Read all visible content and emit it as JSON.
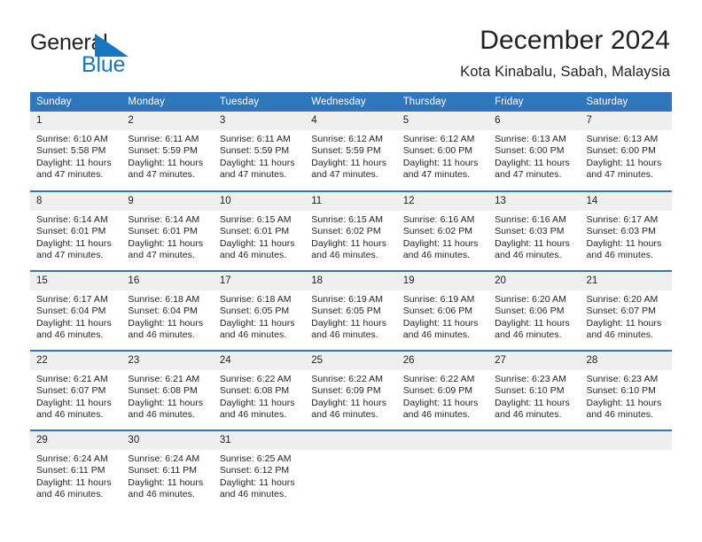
{
  "brand": {
    "name_part1": "General",
    "name_part2": "Blue",
    "triangle_icon": "triangle-icon",
    "accent_color": "#1676c0"
  },
  "header": {
    "title": "December 2024",
    "subtitle": "Kota Kinabalu, Sabah, Malaysia"
  },
  "theme": {
    "header_blue": "#2f76bc",
    "daynum_gray": "#efefef",
    "text": "#231f20"
  },
  "calendar": {
    "weekday_headers": [
      "Sunday",
      "Monday",
      "Tuesday",
      "Wednesday",
      "Thursday",
      "Friday",
      "Saturday"
    ],
    "weeks": [
      [
        {
          "day": "1",
          "sunrise": "Sunrise: 6:10 AM",
          "sunset": "Sunset: 5:58 PM",
          "daylight": "Daylight: 11 hours and 47 minutes."
        },
        {
          "day": "2",
          "sunrise": "Sunrise: 6:11 AM",
          "sunset": "Sunset: 5:59 PM",
          "daylight": "Daylight: 11 hours and 47 minutes."
        },
        {
          "day": "3",
          "sunrise": "Sunrise: 6:11 AM",
          "sunset": "Sunset: 5:59 PM",
          "daylight": "Daylight: 11 hours and 47 minutes."
        },
        {
          "day": "4",
          "sunrise": "Sunrise: 6:12 AM",
          "sunset": "Sunset: 5:59 PM",
          "daylight": "Daylight: 11 hours and 47 minutes."
        },
        {
          "day": "5",
          "sunrise": "Sunrise: 6:12 AM",
          "sunset": "Sunset: 6:00 PM",
          "daylight": "Daylight: 11 hours and 47 minutes."
        },
        {
          "day": "6",
          "sunrise": "Sunrise: 6:13 AM",
          "sunset": "Sunset: 6:00 PM",
          "daylight": "Daylight: 11 hours and 47 minutes."
        },
        {
          "day": "7",
          "sunrise": "Sunrise: 6:13 AM",
          "sunset": "Sunset: 6:00 PM",
          "daylight": "Daylight: 11 hours and 47 minutes."
        }
      ],
      [
        {
          "day": "8",
          "sunrise": "Sunrise: 6:14 AM",
          "sunset": "Sunset: 6:01 PM",
          "daylight": "Daylight: 11 hours and 47 minutes."
        },
        {
          "day": "9",
          "sunrise": "Sunrise: 6:14 AM",
          "sunset": "Sunset: 6:01 PM",
          "daylight": "Daylight: 11 hours and 47 minutes."
        },
        {
          "day": "10",
          "sunrise": "Sunrise: 6:15 AM",
          "sunset": "Sunset: 6:01 PM",
          "daylight": "Daylight: 11 hours and 46 minutes."
        },
        {
          "day": "11",
          "sunrise": "Sunrise: 6:15 AM",
          "sunset": "Sunset: 6:02 PM",
          "daylight": "Daylight: 11 hours and 46 minutes."
        },
        {
          "day": "12",
          "sunrise": "Sunrise: 6:16 AM",
          "sunset": "Sunset: 6:02 PM",
          "daylight": "Daylight: 11 hours and 46 minutes."
        },
        {
          "day": "13",
          "sunrise": "Sunrise: 6:16 AM",
          "sunset": "Sunset: 6:03 PM",
          "daylight": "Daylight: 11 hours and 46 minutes."
        },
        {
          "day": "14",
          "sunrise": "Sunrise: 6:17 AM",
          "sunset": "Sunset: 6:03 PM",
          "daylight": "Daylight: 11 hours and 46 minutes."
        }
      ],
      [
        {
          "day": "15",
          "sunrise": "Sunrise: 6:17 AM",
          "sunset": "Sunset: 6:04 PM",
          "daylight": "Daylight: 11 hours and 46 minutes."
        },
        {
          "day": "16",
          "sunrise": "Sunrise: 6:18 AM",
          "sunset": "Sunset: 6:04 PM",
          "daylight": "Daylight: 11 hours and 46 minutes."
        },
        {
          "day": "17",
          "sunrise": "Sunrise: 6:18 AM",
          "sunset": "Sunset: 6:05 PM",
          "daylight": "Daylight: 11 hours and 46 minutes."
        },
        {
          "day": "18",
          "sunrise": "Sunrise: 6:19 AM",
          "sunset": "Sunset: 6:05 PM",
          "daylight": "Daylight: 11 hours and 46 minutes."
        },
        {
          "day": "19",
          "sunrise": "Sunrise: 6:19 AM",
          "sunset": "Sunset: 6:06 PM",
          "daylight": "Daylight: 11 hours and 46 minutes."
        },
        {
          "day": "20",
          "sunrise": "Sunrise: 6:20 AM",
          "sunset": "Sunset: 6:06 PM",
          "daylight": "Daylight: 11 hours and 46 minutes."
        },
        {
          "day": "21",
          "sunrise": "Sunrise: 6:20 AM",
          "sunset": "Sunset: 6:07 PM",
          "daylight": "Daylight: 11 hours and 46 minutes."
        }
      ],
      [
        {
          "day": "22",
          "sunrise": "Sunrise: 6:21 AM",
          "sunset": "Sunset: 6:07 PM",
          "daylight": "Daylight: 11 hours and 46 minutes."
        },
        {
          "day": "23",
          "sunrise": "Sunrise: 6:21 AM",
          "sunset": "Sunset: 6:08 PM",
          "daylight": "Daylight: 11 hours and 46 minutes."
        },
        {
          "day": "24",
          "sunrise": "Sunrise: 6:22 AM",
          "sunset": "Sunset: 6:08 PM",
          "daylight": "Daylight: 11 hours and 46 minutes."
        },
        {
          "day": "25",
          "sunrise": "Sunrise: 6:22 AM",
          "sunset": "Sunset: 6:09 PM",
          "daylight": "Daylight: 11 hours and 46 minutes."
        },
        {
          "day": "26",
          "sunrise": "Sunrise: 6:22 AM",
          "sunset": "Sunset: 6:09 PM",
          "daylight": "Daylight: 11 hours and 46 minutes."
        },
        {
          "day": "27",
          "sunrise": "Sunrise: 6:23 AM",
          "sunset": "Sunset: 6:10 PM",
          "daylight": "Daylight: 11 hours and 46 minutes."
        },
        {
          "day": "28",
          "sunrise": "Sunrise: 6:23 AM",
          "sunset": "Sunset: 6:10 PM",
          "daylight": "Daylight: 11 hours and 46 minutes."
        }
      ],
      [
        {
          "day": "29",
          "sunrise": "Sunrise: 6:24 AM",
          "sunset": "Sunset: 6:11 PM",
          "daylight": "Daylight: 11 hours and 46 minutes."
        },
        {
          "day": "30",
          "sunrise": "Sunrise: 6:24 AM",
          "sunset": "Sunset: 6:11 PM",
          "daylight": "Daylight: 11 hours and 46 minutes."
        },
        {
          "day": "31",
          "sunrise": "Sunrise: 6:25 AM",
          "sunset": "Sunset: 6:12 PM",
          "daylight": "Daylight: 11 hours and 46 minutes."
        },
        {
          "day": "",
          "sunrise": "",
          "sunset": "",
          "daylight": ""
        },
        {
          "day": "",
          "sunrise": "",
          "sunset": "",
          "daylight": ""
        },
        {
          "day": "",
          "sunrise": "",
          "sunset": "",
          "daylight": ""
        },
        {
          "day": "",
          "sunrise": "",
          "sunset": "",
          "daylight": ""
        }
      ]
    ]
  }
}
